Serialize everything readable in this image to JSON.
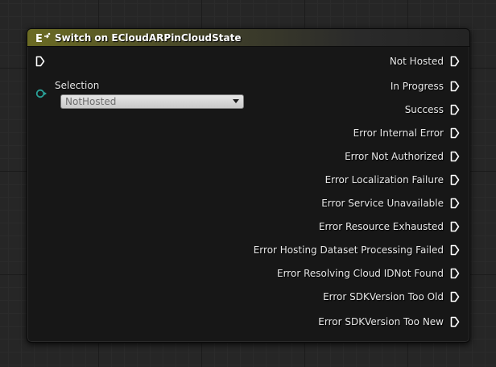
{
  "node": {
    "title": "Switch on ECloudARPinCloudState",
    "header_icon": "enum-switch-icon",
    "colors": {
      "header_accent": "#6b6b24",
      "pin_white": "#ffffff",
      "selection_pin": "#2aa198"
    }
  },
  "selection": {
    "label": "Selection",
    "value": "NotHosted"
  },
  "outputs": [
    "Not Hosted",
    "In Progress",
    "Success",
    "Error Internal Error",
    "Error Not Authorized",
    "Error Localization Failure",
    "Error Service Unavailable",
    "Error Resource Exhausted",
    "Error Hosting Dataset Processing Failed",
    "Error Resolving Cloud IDNot Found",
    "Error SDKVersion Too Old",
    "Error SDKVersion Too New"
  ]
}
